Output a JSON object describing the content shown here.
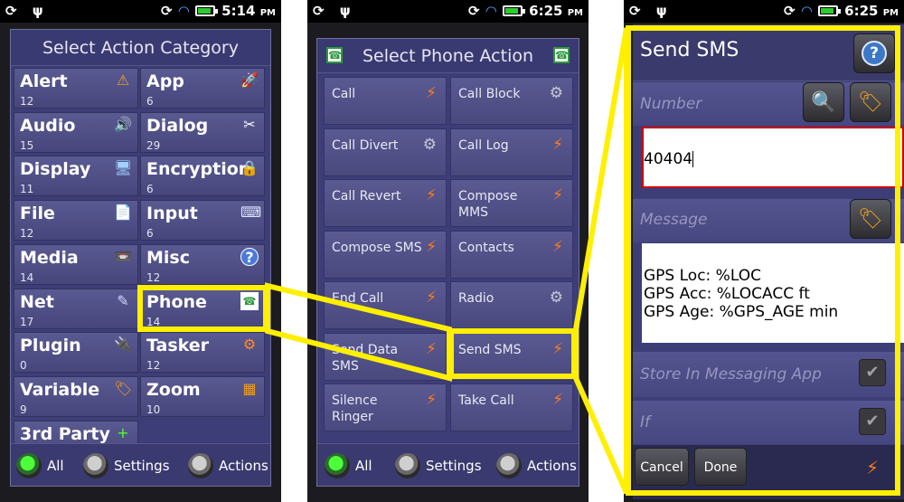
{
  "phone1": {
    "status": {
      "left_icons": "⟳ ψ",
      "time": "5:14",
      "ampm": "PM"
    },
    "title": "Select Action Category",
    "categories": [
      {
        "name": "Alert",
        "count": "12",
        "icon": "⚠"
      },
      {
        "name": "App",
        "count": "6",
        "icon": "🚀"
      },
      {
        "name": "Audio",
        "count": "15",
        "icon": "🔊"
      },
      {
        "name": "Dialog",
        "count": "29",
        "icon": "✂"
      },
      {
        "name": "Display",
        "count": "11",
        "icon": "🖥"
      },
      {
        "name": "Encryption",
        "count": "6",
        "icon": "🔒"
      },
      {
        "name": "File",
        "count": "12",
        "icon": "📄"
      },
      {
        "name": "Input",
        "count": "6",
        "icon": "⌨"
      },
      {
        "name": "Media",
        "count": "14",
        "icon": "📼"
      },
      {
        "name": "Misc",
        "count": "12",
        "icon": "?"
      },
      {
        "name": "Net",
        "count": "17",
        "icon": "✎"
      },
      {
        "name": "Phone",
        "count": "14",
        "icon": "☎"
      },
      {
        "name": "Plugin",
        "count": "0",
        "icon": "🔌"
      },
      {
        "name": "Tasker",
        "count": "12",
        "icon": "⚙"
      },
      {
        "name": "Variable",
        "count": "9",
        "icon": "🏷"
      },
      {
        "name": "Zoom",
        "count": "10",
        "icon": "▦"
      },
      {
        "name": "3rd Party",
        "count": "",
        "icon": "+"
      }
    ],
    "filters": {
      "all": "All",
      "settings": "Settings",
      "actions": "Actions"
    }
  },
  "phone2": {
    "status": {
      "left_icons": "⟳ ψ",
      "time": "6:25",
      "ampm": "PM"
    },
    "title": "Select Phone Action",
    "actions": [
      {
        "name": "Call",
        "icon": "bolt"
      },
      {
        "name": "Call Block",
        "icon": "gear"
      },
      {
        "name": "Call Divert",
        "icon": "gear"
      },
      {
        "name": "Call Log",
        "icon": "bolt"
      },
      {
        "name": "Call Revert",
        "icon": "bolt"
      },
      {
        "name": "Compose MMS",
        "icon": "bolt"
      },
      {
        "name": "Compose SMS",
        "icon": "bolt"
      },
      {
        "name": "Contacts",
        "icon": "bolt"
      },
      {
        "name": "End Call",
        "icon": "bolt"
      },
      {
        "name": "Radio",
        "icon": "gear"
      },
      {
        "name": "Send Data SMS",
        "icon": "bolt"
      },
      {
        "name": "Send SMS",
        "icon": "bolt"
      },
      {
        "name": "Silence Ringer",
        "icon": "bolt"
      },
      {
        "name": "Take Call",
        "icon": "bolt"
      }
    ],
    "filters": {
      "all": "All",
      "settings": "Settings",
      "actions": "Actions"
    }
  },
  "phone3": {
    "status": {
      "left_icons": "⟳ ψ",
      "time": "6:25",
      "ampm": "PM"
    },
    "title": "Send SMS",
    "number_label": "Number",
    "number_value": "40404",
    "message_label": "Message",
    "message_lines": [
      "GPS Loc: %LOC",
      "GPS Acc: %LOCACC ft",
      "GPS Age: %GPS_AGE min"
    ],
    "store_label": "Store In Messaging App",
    "if_label": "If",
    "cancel": "Cancel",
    "done": "Done"
  },
  "colors": {
    "highlight": "#ffef00",
    "panel": "#3d3d78",
    "bolt": "#ff7a1a"
  }
}
